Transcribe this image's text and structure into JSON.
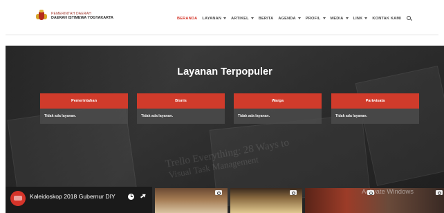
{
  "header": {
    "logo": {
      "line1": "PEMERINTAH DAERAH",
      "line2": "DAERAH ISTIMEWA YOGYAKARTA"
    },
    "nav": [
      {
        "label": "BERANDA",
        "active": true,
        "dropdown": false
      },
      {
        "label": "LAYANAN",
        "active": false,
        "dropdown": true
      },
      {
        "label": "ARTIKEL",
        "active": false,
        "dropdown": true
      },
      {
        "label": "BERITA",
        "active": false,
        "dropdown": false
      },
      {
        "label": "AGENDA",
        "active": false,
        "dropdown": true
      },
      {
        "label": "PROFIL",
        "active": false,
        "dropdown": true
      },
      {
        "label": "MEDIA",
        "active": false,
        "dropdown": true
      },
      {
        "label": "LINK",
        "active": false,
        "dropdown": true
      },
      {
        "label": "KONTAK KAMI",
        "active": false,
        "dropdown": false
      }
    ],
    "search_icon": "search-icon"
  },
  "hero": {
    "title": "Layanan Terpopuler",
    "background_text": [
      "Trello Everything: 28 Ways to",
      "Visual Task Management"
    ],
    "cards": [
      {
        "title": "Pemerintahan",
        "body": "Tidak ada layanan."
      },
      {
        "title": "Bisnis",
        "body": "Tidak ada layanan."
      },
      {
        "title": "Warga",
        "body": "Tidak ada layanan."
      },
      {
        "title": "Pariwisata",
        "body": "Tidak ada layanan."
      }
    ]
  },
  "video": {
    "title": "Kaleidoskop 2018 Gubernur DIY",
    "icons": [
      "clock-icon",
      "share-icon"
    ]
  },
  "watermark": "Activate Windows",
  "colors": {
    "accent": "#d03b2b",
    "active_nav": "#d4362a",
    "card_body": "#4b4b4b"
  }
}
